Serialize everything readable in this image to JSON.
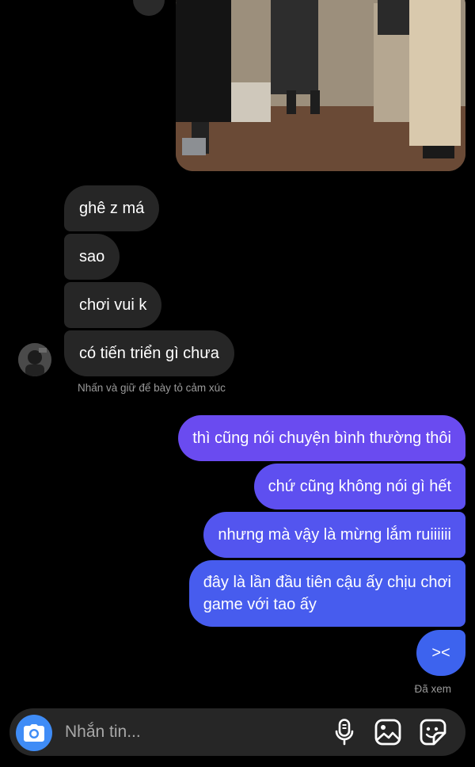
{
  "received_messages": [
    {
      "text": "ghê z má"
    },
    {
      "text": "sao"
    },
    {
      "text": "chơi vui k"
    },
    {
      "text": "có tiến triển gì chưa"
    }
  ],
  "reaction_hint": "Nhấn và giữ để bày tỏ cảm xúc",
  "sent_messages": [
    {
      "text": "thì cũng nói chuyện bình thường thôi"
    },
    {
      "text": "chứ cũng không nói gì hết"
    },
    {
      "text": "nhưng mà vậy là mừng lắm ruiiiiii"
    },
    {
      "text_line1": "đây là lần đầu tiên cậu ấy chịu chơi",
      "text_line2": "game với tao ấy"
    },
    {
      "text": "><"
    }
  ],
  "seen_status": "Đã xem",
  "composer": {
    "placeholder": "Nhắn tin...",
    "icons": [
      "camera-icon",
      "microphone-icon",
      "gallery-icon",
      "sticker-icon"
    ]
  },
  "colors": {
    "background": "#000000",
    "received_bubble": "#262626",
    "sent_bubble_top": "#6a4bf0",
    "sent_bubble_bottom": "#3d63ee",
    "camera_button": "#3f8cf6",
    "muted_text": "#9a9a9a"
  }
}
